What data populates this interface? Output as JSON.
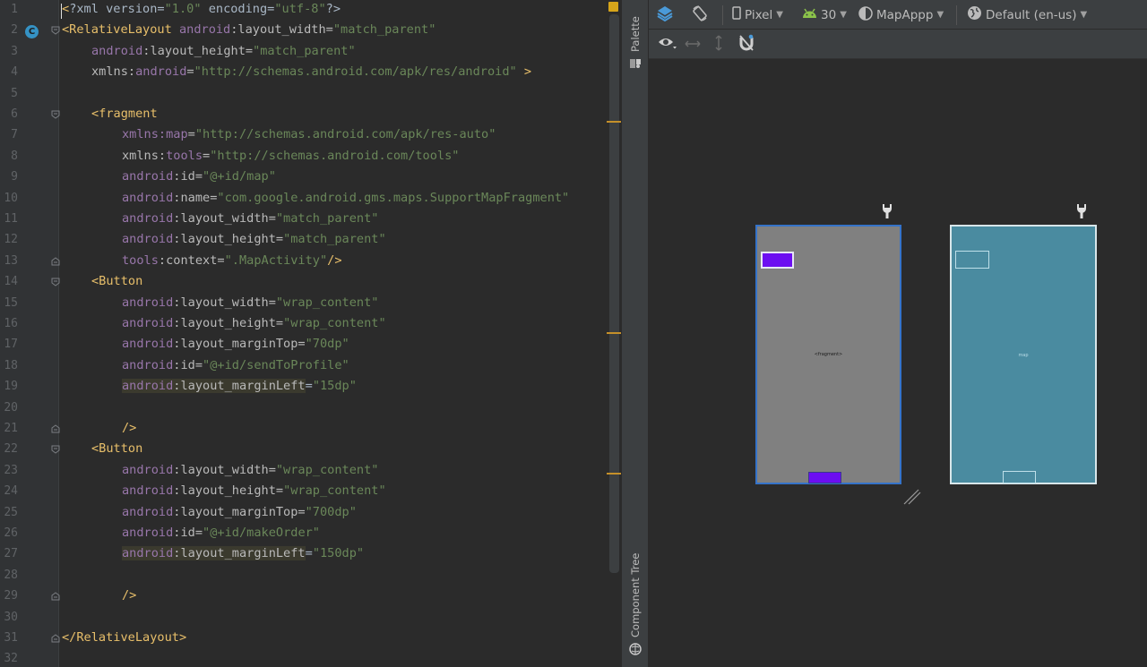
{
  "editor": {
    "lines": [
      {
        "n": "1",
        "indent": 0,
        "fold": "",
        "hl": false,
        "tokens": [
          [
            "t-punc",
            "<"
          ],
          [
            "t-plain",
            "?xml version="
          ],
          [
            "t-val",
            "\"1.0\""
          ],
          [
            "t-plain",
            " encoding="
          ],
          [
            "t-val",
            "\"utf-8\""
          ],
          [
            "t-plain",
            "?>"
          ]
        ]
      },
      {
        "n": "2",
        "indent": 0,
        "fold": "open",
        "hl": false,
        "tokens": [
          [
            "t-tag",
            "<RelativeLayout "
          ],
          [
            "t-ns",
            "android"
          ],
          [
            "t-attr",
            ":layout_width="
          ],
          [
            "t-val",
            "\"match_parent\""
          ]
        ]
      },
      {
        "n": "3",
        "indent": 1,
        "fold": "",
        "hl": false,
        "tokens": [
          [
            "t-ns",
            "android"
          ],
          [
            "t-attr",
            ":layout_height="
          ],
          [
            "t-val",
            "\"match_parent\""
          ]
        ]
      },
      {
        "n": "4",
        "indent": 1,
        "fold": "",
        "hl": false,
        "tokens": [
          [
            "t-attr",
            "xmlns:"
          ],
          [
            "t-ns",
            "android"
          ],
          [
            "t-attr",
            "="
          ],
          [
            "t-val",
            "\"http://schemas.android.com/apk/res/android\""
          ],
          [
            "t-tag",
            " >"
          ]
        ]
      },
      {
        "n": "5",
        "indent": 0,
        "fold": "",
        "hl": false,
        "tokens": []
      },
      {
        "n": "6",
        "indent": 1,
        "fold": "open",
        "hl": false,
        "tokens": [
          [
            "t-tag",
            "<fragment"
          ]
        ]
      },
      {
        "n": "7",
        "indent": 2,
        "fold": "",
        "hl": false,
        "tokens": [
          [
            "t-ns",
            "xmlns:map"
          ],
          [
            "t-attr",
            "="
          ],
          [
            "t-val",
            "\"http://schemas.android.com/apk/res-auto\""
          ]
        ]
      },
      {
        "n": "8",
        "indent": 2,
        "fold": "",
        "hl": false,
        "tokens": [
          [
            "t-attr",
            "xmlns:"
          ],
          [
            "t-ns",
            "tools"
          ],
          [
            "t-attr",
            "="
          ],
          [
            "t-val",
            "\"http://schemas.android.com/tools\""
          ]
        ]
      },
      {
        "n": "9",
        "indent": 2,
        "fold": "",
        "hl": false,
        "tokens": [
          [
            "t-ns",
            "android"
          ],
          [
            "t-attr",
            ":id="
          ],
          [
            "t-val",
            "\"@+id/map\""
          ]
        ]
      },
      {
        "n": "10",
        "indent": 2,
        "fold": "",
        "hl": false,
        "tokens": [
          [
            "t-ns",
            "android"
          ],
          [
            "t-attr",
            ":name="
          ],
          [
            "t-val",
            "\"com.google.android.gms.maps.SupportMapFragment\""
          ]
        ]
      },
      {
        "n": "11",
        "indent": 2,
        "fold": "",
        "hl": false,
        "tokens": [
          [
            "t-ns",
            "android"
          ],
          [
            "t-attr",
            ":layout_width="
          ],
          [
            "t-val",
            "\"match_parent\""
          ]
        ]
      },
      {
        "n": "12",
        "indent": 2,
        "fold": "",
        "hl": false,
        "tokens": [
          [
            "t-ns",
            "android"
          ],
          [
            "t-attr",
            ":layout_height="
          ],
          [
            "t-val",
            "\"match_parent\""
          ]
        ]
      },
      {
        "n": "13",
        "indent": 2,
        "fold": "close",
        "hl": false,
        "tokens": [
          [
            "t-ns",
            "tools"
          ],
          [
            "t-attr",
            ":context="
          ],
          [
            "t-val",
            "\".MapActivity\""
          ],
          [
            "t-tag",
            "/>"
          ]
        ]
      },
      {
        "n": "14",
        "indent": 1,
        "fold": "open",
        "hl": false,
        "tokens": [
          [
            "t-tag",
            "<Button"
          ]
        ]
      },
      {
        "n": "15",
        "indent": 2,
        "fold": "",
        "hl": false,
        "tokens": [
          [
            "t-ns",
            "android"
          ],
          [
            "t-attr",
            ":layout_width="
          ],
          [
            "t-val",
            "\"wrap_content\""
          ]
        ]
      },
      {
        "n": "16",
        "indent": 2,
        "fold": "",
        "hl": false,
        "tokens": [
          [
            "t-ns",
            "android"
          ],
          [
            "t-attr",
            ":layout_height="
          ],
          [
            "t-val",
            "\"wrap_content\""
          ]
        ]
      },
      {
        "n": "17",
        "indent": 2,
        "fold": "",
        "hl": false,
        "tokens": [
          [
            "t-ns",
            "android"
          ],
          [
            "t-attr",
            ":layout_marginTop="
          ],
          [
            "t-val",
            "\"70dp\""
          ]
        ]
      },
      {
        "n": "18",
        "indent": 2,
        "fold": "",
        "hl": false,
        "tokens": [
          [
            "t-ns",
            "android"
          ],
          [
            "t-attr",
            ":id="
          ],
          [
            "t-val",
            "\"@+id/sendToProfile\""
          ]
        ]
      },
      {
        "n": "19",
        "indent": 2,
        "fold": "",
        "hl": true,
        "tokens": [
          [
            "t-ns",
            "android"
          ],
          [
            "t-attr",
            ":layout_marginLeft"
          ],
          [
            "t-plain",
            "="
          ],
          [
            "t-val",
            "\"15dp\""
          ]
        ]
      },
      {
        "n": "20",
        "indent": 0,
        "fold": "",
        "hl": false,
        "tokens": []
      },
      {
        "n": "21",
        "indent": 2,
        "fold": "close",
        "hl": false,
        "tokens": [
          [
            "t-tag",
            "/>"
          ]
        ]
      },
      {
        "n": "22",
        "indent": 1,
        "fold": "open",
        "hl": false,
        "tokens": [
          [
            "t-tag",
            "<Button"
          ]
        ]
      },
      {
        "n": "23",
        "indent": 2,
        "fold": "",
        "hl": false,
        "tokens": [
          [
            "t-ns",
            "android"
          ],
          [
            "t-attr",
            ":layout_width="
          ],
          [
            "t-val",
            "\"wrap_content\""
          ]
        ]
      },
      {
        "n": "24",
        "indent": 2,
        "fold": "",
        "hl": false,
        "tokens": [
          [
            "t-ns",
            "android"
          ],
          [
            "t-attr",
            ":layout_height="
          ],
          [
            "t-val",
            "\"wrap_content\""
          ]
        ]
      },
      {
        "n": "25",
        "indent": 2,
        "fold": "",
        "hl": false,
        "tokens": [
          [
            "t-ns",
            "android"
          ],
          [
            "t-attr",
            ":layout_marginTop="
          ],
          [
            "t-val",
            "\"700dp\""
          ]
        ]
      },
      {
        "n": "26",
        "indent": 2,
        "fold": "",
        "hl": false,
        "tokens": [
          [
            "t-ns",
            "android"
          ],
          [
            "t-attr",
            ":id="
          ],
          [
            "t-val",
            "\"@+id/makeOrder\""
          ]
        ]
      },
      {
        "n": "27",
        "indent": 2,
        "fold": "",
        "hl": true,
        "tokens": [
          [
            "t-ns",
            "android"
          ],
          [
            "t-attr",
            ":layout_marginLeft"
          ],
          [
            "t-plain",
            "="
          ],
          [
            "t-val",
            "\"150dp\""
          ]
        ]
      },
      {
        "n": "28",
        "indent": 0,
        "fold": "",
        "hl": false,
        "tokens": []
      },
      {
        "n": "29",
        "indent": 2,
        "fold": "close",
        "hl": false,
        "tokens": [
          [
            "t-tag",
            "/>"
          ]
        ]
      },
      {
        "n": "30",
        "indent": 0,
        "fold": "",
        "hl": false,
        "tokens": []
      },
      {
        "n": "31",
        "indent": 0,
        "fold": "close",
        "hl": false,
        "tokens": [
          [
            "t-tag",
            "</RelativeLayout>"
          ]
        ]
      },
      {
        "n": "32",
        "indent": 0,
        "fold": "",
        "hl": false,
        "tokens": []
      }
    ],
    "class_badge": "C"
  },
  "side_tabs": {
    "palette": "Palette",
    "component_tree": "Component Tree"
  },
  "toolbar": {
    "device": "Pixel",
    "api": "30",
    "theme": "MapAppp",
    "locale": "Default (en-us)"
  },
  "preview": {
    "fragment_label": "<fragment>",
    "blueprint_label": "map"
  },
  "colors": {
    "button_purple": "#6c0ef1",
    "design_surface": "#808080",
    "blueprint_surface": "#4a8ba0",
    "selection_blue": "#3573c9"
  }
}
